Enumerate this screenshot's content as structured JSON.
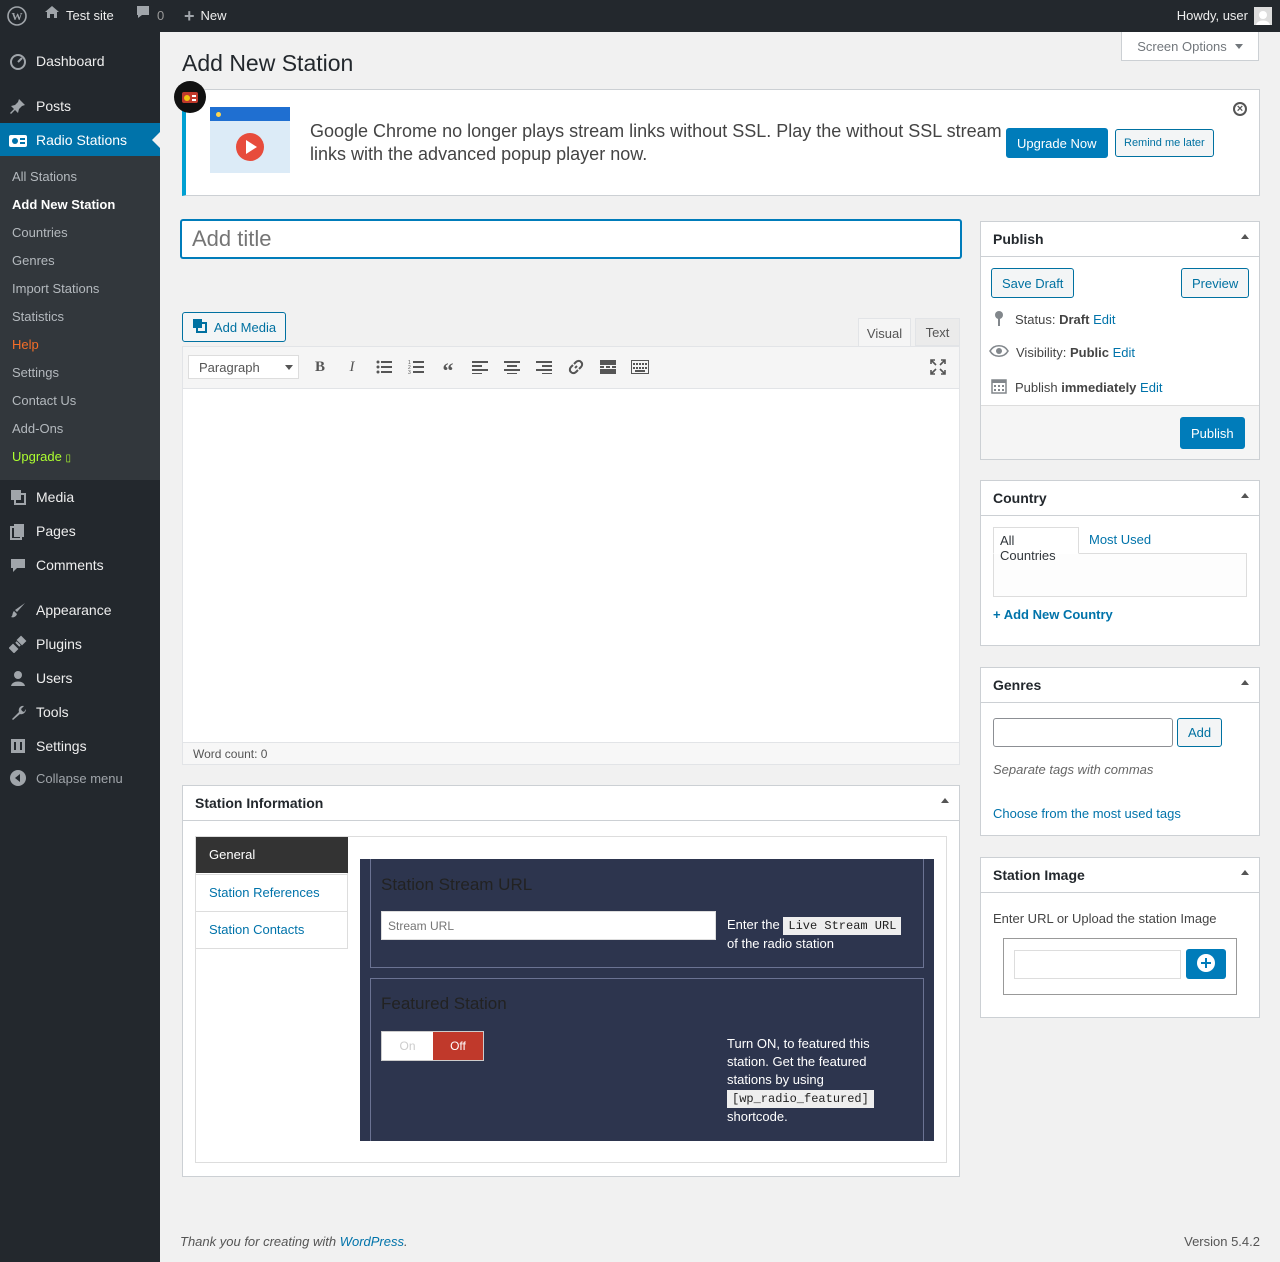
{
  "adminbar": {
    "site": "Test site",
    "comments": "0",
    "new": "New",
    "howdy": "Howdy, user"
  },
  "sidebar": {
    "dashboard": "Dashboard",
    "posts": "Posts",
    "radio_stations": "Radio Stations",
    "submenu": [
      "All Stations",
      "Add New Station",
      "Countries",
      "Genres",
      "Import Stations",
      "Statistics",
      "Help",
      "Settings",
      "Contact Us",
      "Add-Ons",
      "Upgrade"
    ],
    "media": "Media",
    "pages": "Pages",
    "comments": "Comments",
    "appearance": "Appearance",
    "plugins": "Plugins",
    "users": "Users",
    "tools": "Tools",
    "settings": "Settings",
    "collapse": "Collapse menu"
  },
  "screen_options": "Screen Options",
  "page_title": "Add New Station",
  "notice": {
    "text": "Google Chrome no longer plays stream links without SSL. Play the without SSL stream links with the advanced popup player now.",
    "upgrade": "Upgrade Now",
    "remind": "Remind me later"
  },
  "title_placeholder": "Add title",
  "editor": {
    "add_media": "Add Media",
    "tab_visual": "Visual",
    "tab_text": "Text",
    "format": "Paragraph",
    "word_count": "Word count: 0"
  },
  "station_info": {
    "title": "Station Information",
    "tabs": [
      "General",
      "Station References",
      "Station Contacts"
    ],
    "stream_heading": "Station Stream URL",
    "stream_placeholder": "Stream URL",
    "stream_help_pre": "Enter the",
    "stream_help_code": "Live Stream URL",
    "stream_help_post": "of the radio station",
    "featured_heading": "Featured Station",
    "on": "On",
    "off": "Off",
    "featured_help": "Turn ON, to featured this station. Get the featured stations by using",
    "featured_code": "[wp_radio_featured]",
    "featured_help_post": "shortcode."
  },
  "publish": {
    "title": "Publish",
    "save_draft": "Save Draft",
    "preview": "Preview",
    "status_label": "Status:",
    "status_value": "Draft",
    "visibility_label": "Visibility:",
    "visibility_value": "Public",
    "publish_label": "Publish",
    "publish_value": "immediately",
    "edit": "Edit",
    "publish_button": "Publish"
  },
  "country": {
    "title": "Country",
    "tab_all": "All Countries",
    "tab_used": "Most Used",
    "add_new": "+ Add New Country"
  },
  "genres": {
    "title": "Genres",
    "add": "Add",
    "hint": "Separate tags with commas",
    "choose": "Choose from the most used tags"
  },
  "station_image": {
    "title": "Station Image",
    "label": "Enter URL or Upload the station Image"
  },
  "footer": {
    "thanks": "Thank you for creating with",
    "wp": "WordPress",
    "version": "Version 5.4.2"
  }
}
